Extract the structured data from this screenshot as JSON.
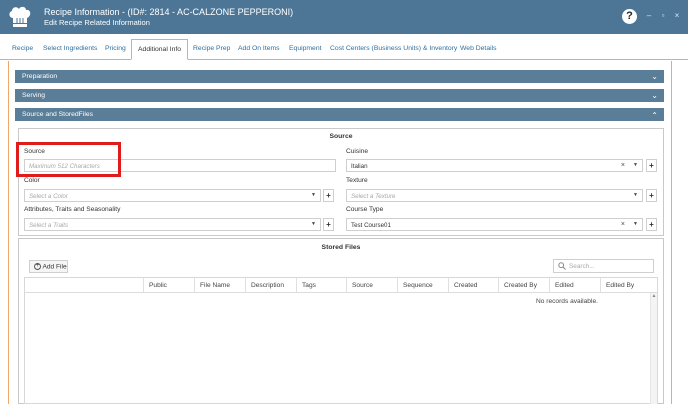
{
  "window": {
    "title": "Recipe Information - (ID#: 2814 - AC-CALZONE PEPPERONI)",
    "subtitle": "Edit Recipe Related Information",
    "help": "?",
    "minimize": "–",
    "restore": "▫",
    "close": "×"
  },
  "tabs": [
    {
      "label": "Recipe"
    },
    {
      "label": "Select Ingredients"
    },
    {
      "label": "Pricing"
    },
    {
      "label": "Additional Info",
      "active": true
    },
    {
      "label": "Recipe Prep"
    },
    {
      "label": "Add On Items"
    },
    {
      "label": "Equipment"
    },
    {
      "label": "Cost Centers (Business Units) & Inventory"
    },
    {
      "label": "Web Details"
    }
  ],
  "sections": {
    "preparation": "Preparation",
    "serving": "Serving",
    "source_stored": "Source and StoredFiles"
  },
  "source_panel": {
    "title": "Source",
    "source_label": "Source",
    "source_placeholder": "Maximum 512 Characters",
    "cuisine_label": "Cuisine",
    "cuisine_value": "Italian",
    "color_label": "Color",
    "color_placeholder": "Select a Color",
    "texture_label": "Texture",
    "texture_placeholder": "Select a Texture",
    "attributes_label": "Attributes, Traits and Seasonality",
    "attributes_placeholder": "Select a Traits",
    "course_type_label": "Course Type",
    "course_type_value": "Test Course01"
  },
  "stored_files": {
    "title": "Stored Files",
    "add_file": "Add File",
    "search_placeholder": "Search...",
    "columns": [
      "Public",
      "File Name",
      "Description",
      "Tags",
      "Source",
      "Sequence",
      "Created",
      "Created By",
      "Edited",
      "Edited By"
    ],
    "empty_message": "No records available."
  },
  "colors": {
    "titlebar": "#4d7696",
    "section_bar": "#5a7d98",
    "tab_accent": "#f0a868",
    "highlight": "#e11a1a"
  }
}
